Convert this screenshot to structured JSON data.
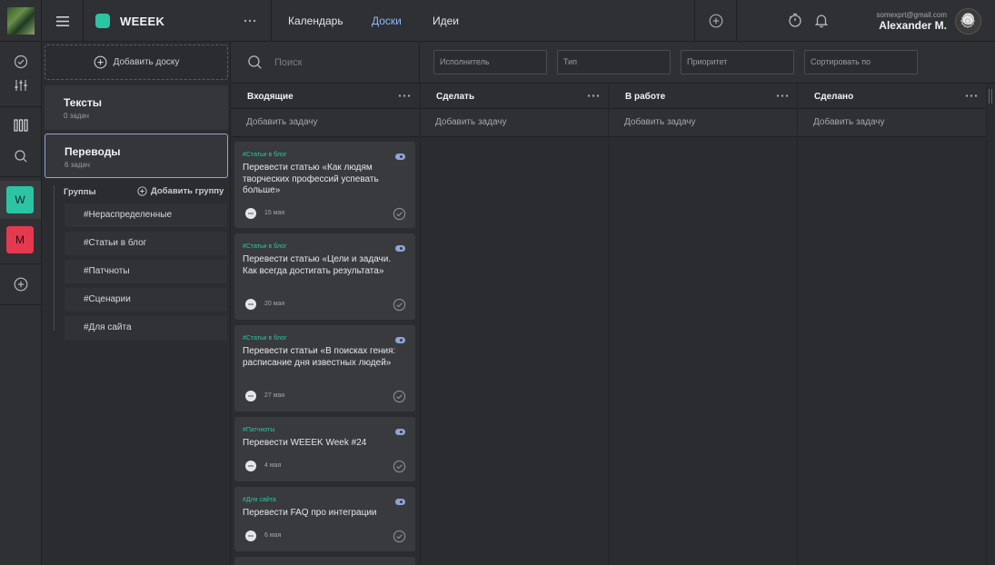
{
  "app": {
    "name": "WEEEK"
  },
  "nav": {
    "calendar": "Календарь",
    "boards": "Доски",
    "ideas": "Идеи"
  },
  "user": {
    "email": "somexprt@gmail.com",
    "name": "Alexander M."
  },
  "workspaces": [
    {
      "letter": "W",
      "color": "#2bc5a4"
    },
    {
      "letter": "M",
      "color": "#e4394f"
    }
  ],
  "boards_panel": {
    "add_board": "Добавить доску",
    "boards": [
      {
        "title": "Тексты",
        "count": "0 задач"
      },
      {
        "title": "Переводы",
        "count": "6 задач"
      }
    ],
    "groups_label": "Группы",
    "add_group": "Добавить группу",
    "groups": [
      "#Нераспределенные",
      "#Статьи в блог",
      "#Патчноты",
      "#Сценарии",
      "#Для сайта"
    ]
  },
  "search": {
    "placeholder": "Поиск"
  },
  "filters": {
    "assignee": "Исполнитель",
    "type": "Тип",
    "priority": "Приоритет",
    "sort": "Сортировать по"
  },
  "columns": [
    {
      "title": "Входящие",
      "add_task": "Добавить задачу"
    },
    {
      "title": "Сделать",
      "add_task": "Добавить задачу"
    },
    {
      "title": "В работе",
      "add_task": "Добавить задачу"
    },
    {
      "title": "Сделано",
      "add_task": "Добавить задачу"
    }
  ],
  "tasks": [
    {
      "tag": "#Статьи в блог",
      "title": "Перевести статью «Как людям творческих профессий успевать больше»",
      "date": "15 мая"
    },
    {
      "tag": "#Статьи в блог",
      "title": "Перевести статью «Цели и задачи. Как всегда достигать результата»",
      "date": "20 мая"
    },
    {
      "tag": "#Статьи в блог",
      "title": "Перевести статьи «В поисках гения: расписание дня известных людей»",
      "date": "27 мая"
    },
    {
      "tag": "#Патчноты",
      "title": "Перевести WEEEK Week #24",
      "date": "4 мая"
    },
    {
      "tag": "#Для сайта",
      "title": "Перевести FAQ про интеграции",
      "date": "6 мая"
    }
  ],
  "colors": {
    "accent": "#2bc5a4",
    "link_active": "#8fb7ff",
    "danger": "#e4394f"
  }
}
